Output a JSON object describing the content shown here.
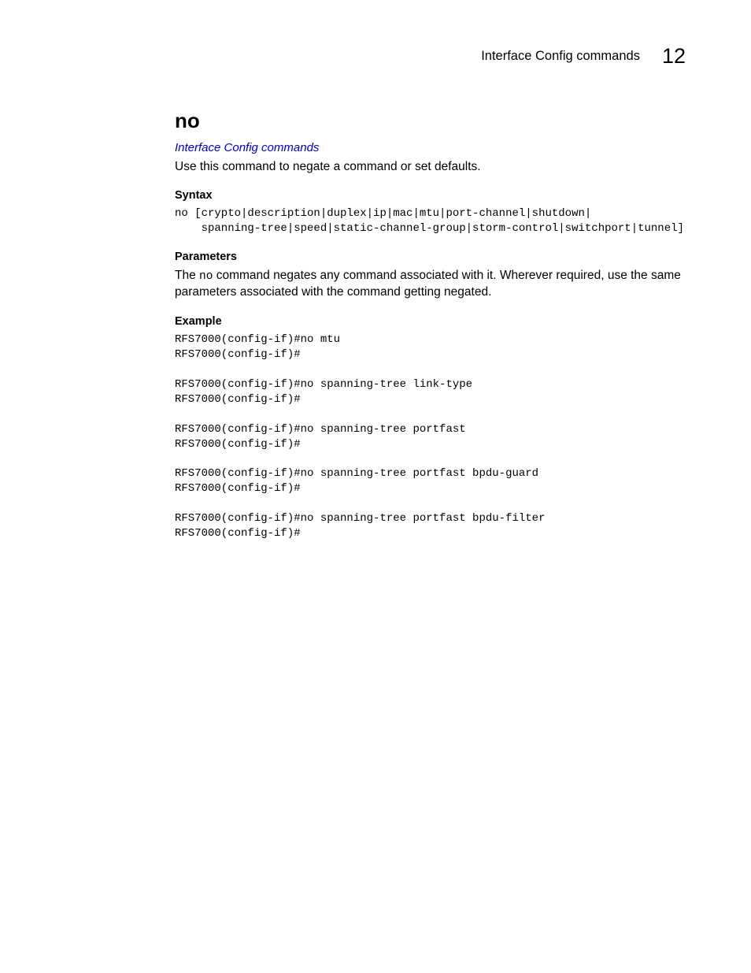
{
  "header": {
    "section": "Interface Config commands",
    "chapter_num": "12"
  },
  "title": "no",
  "link_text": "Interface Config commands",
  "description": "Use this command to negate a command or set defaults.",
  "syntax_label": "Syntax",
  "syntax_code": "no [crypto|description|duplex|ip|mac|mtu|port-channel|shutdown|\n    spanning-tree|speed|static-channel-group|storm-control|switchport|tunnel]",
  "parameters_label": "Parameters",
  "parameters_text_pre": "The ",
  "parameters_inline": "no",
  "parameters_text_post": " command negates any command associated with it. Wherever required, use the same parameters associated with the command getting negated.",
  "example_label": "Example",
  "example_code": "RFS7000(config-if)#no mtu\nRFS7000(config-if)#\n\nRFS7000(config-if)#no spanning-tree link-type\nRFS7000(config-if)#\n\nRFS7000(config-if)#no spanning-tree portfast\nRFS7000(config-if)#\n\nRFS7000(config-if)#no spanning-tree portfast bpdu-guard\nRFS7000(config-if)#\n\nRFS7000(config-if)#no spanning-tree portfast bpdu-filter\nRFS7000(config-if)#"
}
